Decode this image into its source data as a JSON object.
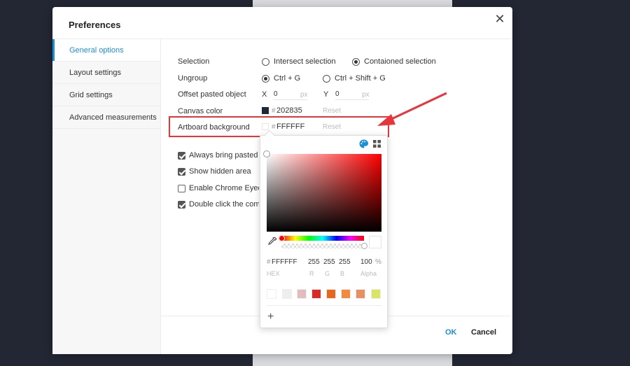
{
  "dialog": {
    "title": "Preferences",
    "close_icon": "close-icon"
  },
  "sidebar": {
    "items": [
      {
        "label": "General options",
        "active": true
      },
      {
        "label": "Layout settings",
        "active": false
      },
      {
        "label": "Grid settings",
        "active": false
      },
      {
        "label": "Advanced measurements",
        "active": false
      }
    ]
  },
  "general": {
    "selection": {
      "label": "Selection",
      "options": [
        "Intersect selection",
        "Contaioned selection"
      ],
      "selected": "Contaioned selection"
    },
    "ungroup": {
      "label": "Ungroup",
      "options": [
        "Ctrl + G",
        "Ctrl + Shift + G"
      ],
      "selected": "Ctrl + G"
    },
    "offset": {
      "label": "Offset pasted object",
      "x_label": "X",
      "x_value": "0",
      "y_label": "Y",
      "y_value": "0",
      "unit": "px"
    },
    "canvas_color": {
      "label": "Canvas color",
      "hash": "#",
      "value": "202835",
      "swatch": "#202835",
      "reset": "Reset"
    },
    "artboard_background": {
      "label": "Artboard background",
      "hash": "#",
      "value": "FFFFFF",
      "swatch": "#FFFFFF",
      "reset": "Reset"
    },
    "checkboxes": [
      {
        "label": "Always bring pasted obj",
        "checked": true
      },
      {
        "label": "Show hidden area",
        "checked": true
      },
      {
        "label": "Enable Chrome Eyedrop",
        "checked": false
      },
      {
        "label": "Double click the compor",
        "checked": true
      }
    ]
  },
  "footer": {
    "ok": "OK",
    "cancel": "Cancel"
  },
  "color_picker": {
    "icons": [
      "palette-icon",
      "grid-icon",
      "eyedropper-icon",
      "plus-icon"
    ],
    "hex_hash": "#",
    "hex": "FFFFFF",
    "r": "255",
    "g": "255",
    "b": "255",
    "alpha": "100",
    "alpha_unit": "%",
    "captions": {
      "hex": "HEX",
      "r": "R",
      "g": "G",
      "b": "B",
      "alpha": "Alpha"
    },
    "presets": [
      "#ffffff",
      "#eeeeee",
      "#e2bcbe",
      "#d82b27",
      "#e8671f",
      "#f08a3e",
      "#e69163",
      "#dbe564"
    ],
    "add_label": "+"
  },
  "colors": {
    "accent": "#1a8fd6",
    "highlight": "#e8353a",
    "backdrop": "#232733"
  }
}
